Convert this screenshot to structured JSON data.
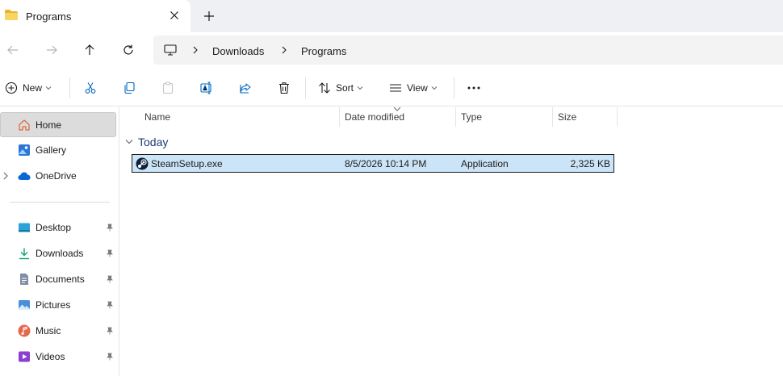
{
  "window": {
    "tab_title": "Programs",
    "icons": {
      "folder": "folder-icon",
      "close": "close-icon",
      "new_tab": "plus-icon"
    }
  },
  "navigation": {
    "icons": [
      "back-arrow-icon",
      "forward-arrow-icon",
      "up-arrow-icon",
      "refresh-icon"
    ],
    "breadcrumb": [
      "Downloads",
      "Programs"
    ],
    "root_icon": "computer-icon"
  },
  "toolbar": {
    "new_label": "New",
    "sort_label": "Sort",
    "view_label": "View",
    "icons": [
      "cut-icon",
      "copy-icon",
      "paste-icon",
      "rename-icon",
      "share-icon",
      "delete-icon",
      "more-icon"
    ]
  },
  "sidebar": {
    "items": [
      {
        "label": "Home",
        "icon": "home-icon",
        "selected": true
      },
      {
        "label": "Gallery",
        "icon": "gallery-icon"
      },
      {
        "label": "OneDrive",
        "icon": "cloud-icon",
        "expandable": true
      }
    ],
    "quick_access": [
      {
        "label": "Desktop",
        "icon": "desktop-icon",
        "pinned": true
      },
      {
        "label": "Downloads",
        "icon": "download-icon",
        "pinned": true
      },
      {
        "label": "Documents",
        "icon": "document-icon",
        "pinned": true
      },
      {
        "label": "Pictures",
        "icon": "pictures-icon",
        "pinned": true
      },
      {
        "label": "Music",
        "icon": "music-icon",
        "pinned": true
      },
      {
        "label": "Videos",
        "icon": "video-icon",
        "pinned": true
      }
    ]
  },
  "file_list": {
    "columns": [
      "Name",
      "Date modified",
      "Type",
      "Size"
    ],
    "group_label": "Today",
    "rows": [
      {
        "name": "SteamSetup.exe",
        "date": "8/5/2026 10:14 PM",
        "type": "Application",
        "size": "2,325 KB",
        "icon": "steam-icon",
        "selected": true
      }
    ]
  },
  "colors": {
    "accent": "#0067c0",
    "selection": "#cce4f7",
    "group_text": "#1f3a78",
    "folder": "#f4c53e"
  }
}
